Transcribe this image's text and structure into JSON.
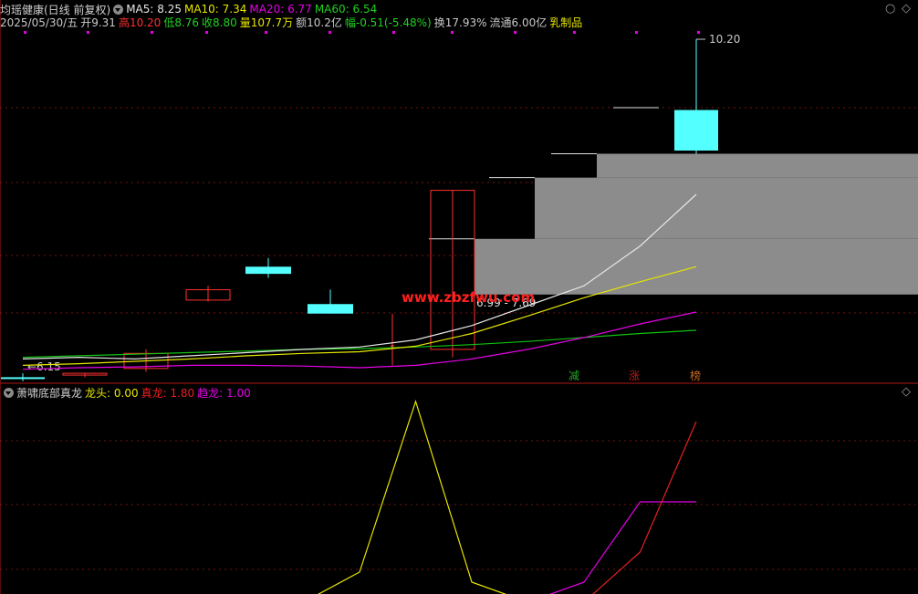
{
  "header": {
    "stock_name": "均瑶健康(日线 前复权)",
    "ma5_label": "MA5: 8.25",
    "ma10_label": "MA10: 7.34",
    "ma20_label": "MA20: 6.77",
    "ma60_label": "MA60: 6.54",
    "date": "2025/05/30/五",
    "open": "开9.31",
    "high": "高10.20",
    "low": "低8.76",
    "close": "收8.80",
    "volume": "量107.7万",
    "amount": "额10.2亿",
    "change": "幅-0.51(-5.48%)",
    "turnover": "换17.93%",
    "float_cap": "流通6.00亿",
    "sector": "乳制品"
  },
  "indicator": {
    "name": "萧啸底部真龙",
    "longtou_label": "龙头: 0.00",
    "zhenlong_label": "真龙: 1.80",
    "qulong_label": "趋龙: 1.00"
  },
  "icons": {
    "top_right_1": "circle-icon",
    "top_right_2": "diamond-icon",
    "bottom_right": "diamond-icon"
  },
  "colors": {
    "bg": "#000000",
    "up": "#ff3030",
    "down": "#54ffff",
    "ma5": "#e6e6e6",
    "ma10": "#e6e600",
    "ma20": "#e600e6",
    "ma60": "#10c010",
    "zone": "#8c8c8c",
    "watermark": "#ff2020",
    "longtou": "#e6e600",
    "zhenlong": "#e62020",
    "qulong": "#e600e6"
  },
  "chart_data": {
    "type": "candlestick",
    "watermark": "www.zbzfwu.com",
    "candles": [
      {
        "o": 5.95,
        "h": 6.0,
        "l": 5.9,
        "c": 5.93
      },
      {
        "o": 5.99,
        "h": 6.0,
        "l": 5.95,
        "c": 6.0
      },
      {
        "o": 6.06,
        "h": 6.3,
        "l": 6.02,
        "c": 6.25
      },
      {
        "o": 6.92,
        "h": 7.1,
        "l": 6.9,
        "c": 7.05
      },
      {
        "o": 7.34,
        "h": 7.45,
        "l": 7.2,
        "c": 7.25
      },
      {
        "o": 6.87,
        "h": 7.05,
        "l": 6.75,
        "c": 6.75
      },
      {
        "o": 6.35,
        "h": 6.75,
        "l": 6.1,
        "c": 6.35
      },
      {
        "o": 6.3,
        "h": 8.3,
        "l": 6.2,
        "c": 8.3
      },
      {
        "o": 9.31,
        "h": 10.2,
        "l": 8.76,
        "c": 8.8
      }
    ],
    "annotations": {
      "high_label": "10.20",
      "low_label": "6.15"
    },
    "zones": [
      {
        "low": 8.46,
        "high": 8.76,
        "label": "8.46 - 8.76"
      },
      {
        "low": 7.69,
        "high": 8.46,
        "label": "7.69 - 8.46"
      },
      {
        "low": 6.99,
        "high": 7.69,
        "label": "6.99 - 7.69"
      }
    ],
    "ma5": [
      6.18,
      6.2,
      6.18,
      6.22,
      6.26,
      6.3,
      6.33,
      6.42,
      6.6,
      6.85,
      7.1,
      7.6,
      8.25
    ],
    "ma10": [
      6.1,
      6.12,
      6.15,
      6.18,
      6.22,
      6.25,
      6.27,
      6.34,
      6.5,
      6.72,
      6.95,
      7.15,
      7.34
    ],
    "ma20": [
      6.05,
      6.07,
      6.08,
      6.1,
      6.1,
      6.09,
      6.07,
      6.1,
      6.18,
      6.3,
      6.45,
      6.62,
      6.77
    ],
    "ma60": [
      6.2,
      6.22,
      6.24,
      6.26,
      6.28,
      6.3,
      6.31,
      6.33,
      6.36,
      6.4,
      6.45,
      6.5,
      6.54
    ],
    "markers": [
      "减",
      "涨",
      "榜"
    ],
    "indicator_series": {
      "longtou": [
        0,
        0,
        0,
        0,
        0,
        0,
        0.3,
        2.0,
        0.2,
        0,
        0,
        0,
        0
      ],
      "zhenlong": [
        0,
        0,
        0,
        0,
        0,
        0,
        0,
        0,
        0,
        0,
        0,
        0.5,
        1.8
      ],
      "qulong": [
        0,
        0,
        0,
        0,
        0,
        0,
        0,
        0,
        0,
        0,
        0.2,
        1.0,
        1.0
      ]
    }
  }
}
